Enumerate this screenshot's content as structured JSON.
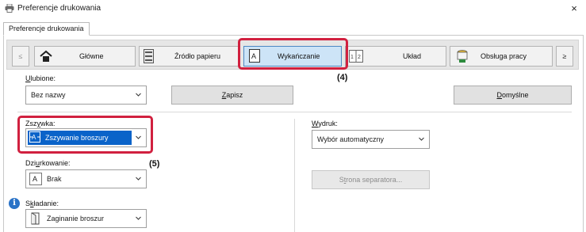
{
  "window": {
    "title": "Preferencje drukowania",
    "close_glyph": "×",
    "app_icon": "printer-icon"
  },
  "tabs": [
    {
      "label": "Preferencje drukowania",
      "selected": true
    }
  ],
  "nav": {
    "prev_glyph": "≤",
    "next_glyph": "≥",
    "items": [
      {
        "label": "Główne",
        "icon": "home-icon",
        "selected": false
      },
      {
        "label": "Źródło papieru",
        "icon": "paper-tray-icon",
        "selected": false
      },
      {
        "label": "Wykańczanie",
        "icon": "finishing-icon",
        "selected": true
      },
      {
        "label": "Układ",
        "icon": "layout-icon",
        "selected": false
      },
      {
        "label": "Obsługa pracy",
        "icon": "job-handling-icon",
        "selected": false
      }
    ]
  },
  "callouts": {
    "four": "(4)",
    "five": "(5)"
  },
  "favorites": {
    "label_underline": "U",
    "label_rest": "lubione:",
    "value": "Bez nazwy",
    "save_label": "Zapisz",
    "save_underline": "Z",
    "default_label": "Domyślne",
    "default_underline": "D"
  },
  "staple": {
    "label_pre": "Zsz",
    "label_underline": "y",
    "label_post": "wka:",
    "value": "Zszywanie broszury"
  },
  "punch": {
    "label_pre": "Dzi",
    "label_underline": "u",
    "label_post": "rkowanie:",
    "value": "Brak"
  },
  "fold": {
    "label_pre": "S",
    "label_underline": "k",
    "label_post": "ładanie:",
    "value": "Zaginanie broszur"
  },
  "output": {
    "label_underline": "W",
    "label_rest": "ydruk:",
    "value": "Wybór automatyczny"
  },
  "separator": {
    "label_pre": "S",
    "label_underline": "t",
    "label_post": "rona separatora..."
  },
  "colors": {
    "highlight_red": "#d1203f",
    "selected_blue": "#0a63c9",
    "nav_selected_bg": "#cde4f7"
  }
}
